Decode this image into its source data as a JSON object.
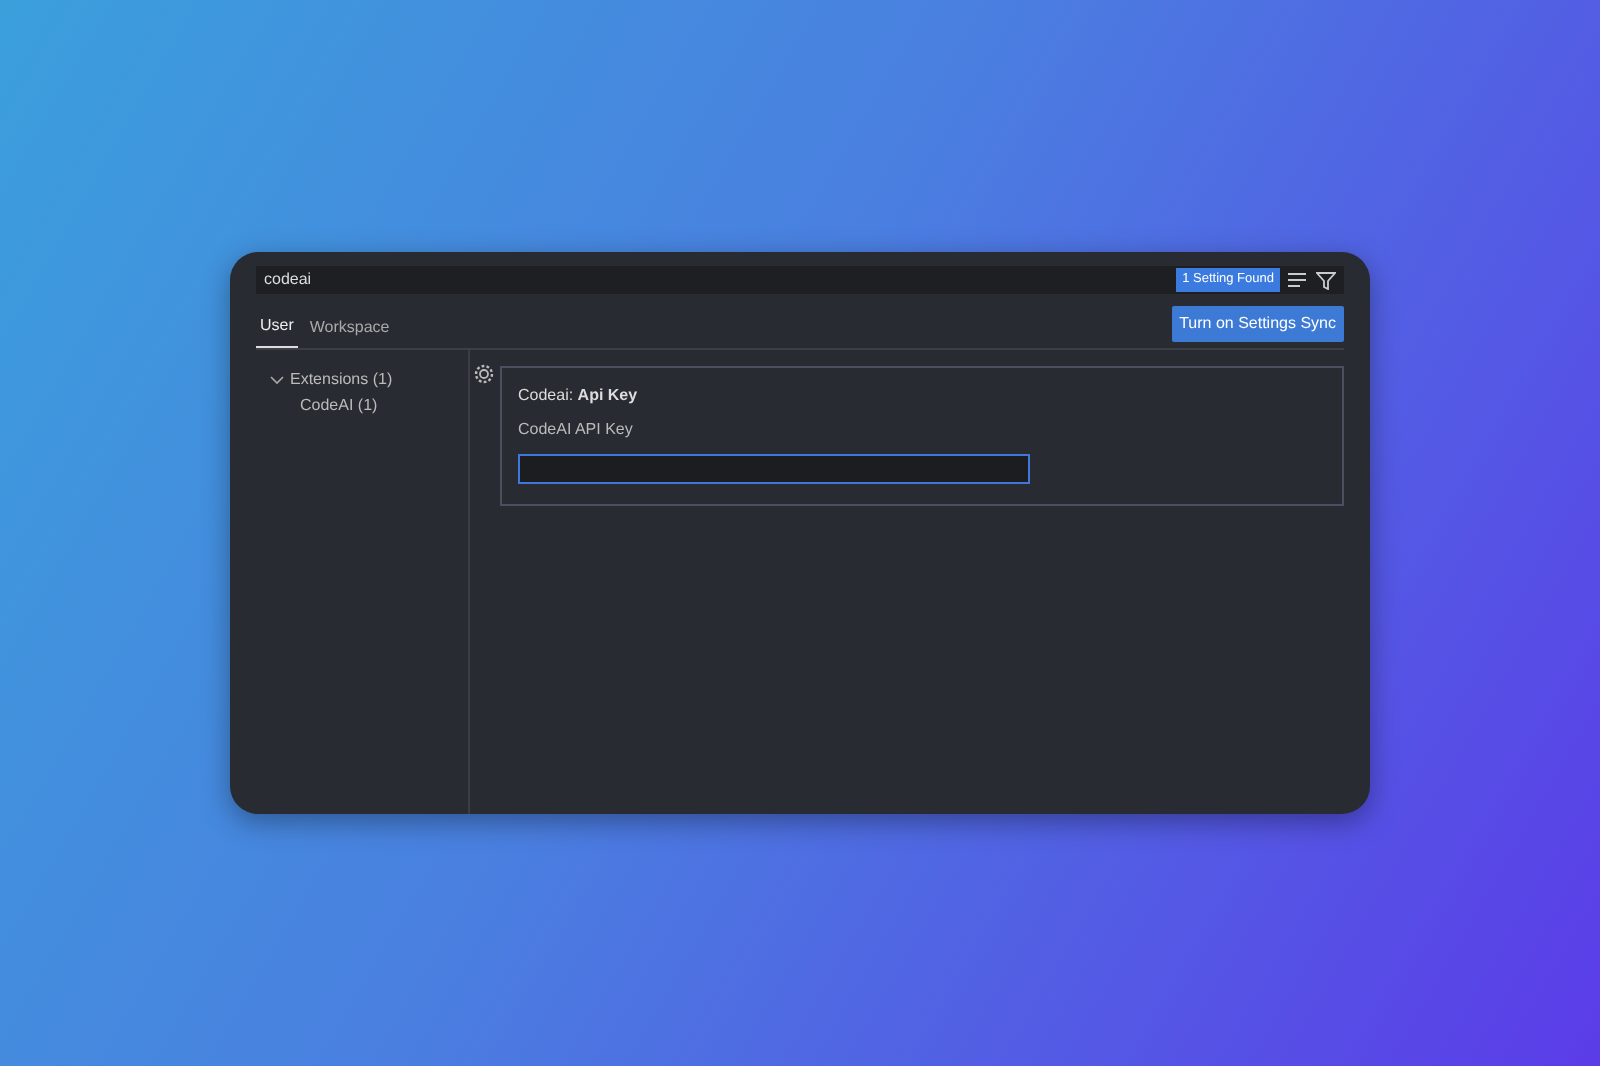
{
  "search": {
    "value": "codeai",
    "result_badge": "1 Setting Found"
  },
  "tabs": [
    {
      "label": "User",
      "selected": true
    },
    {
      "label": "Workspace",
      "selected": false
    }
  ],
  "sync_button": "Turn on Settings Sync",
  "toc": [
    {
      "label": "Extensions (1)",
      "expanded": true,
      "children": [
        {
          "label": "CodeAI (1)"
        }
      ]
    }
  ],
  "settings": [
    {
      "title": "Codeai: **Api Key**",
      "description": "CodeAI API Key",
      "focused": true
    }
  ]
}
